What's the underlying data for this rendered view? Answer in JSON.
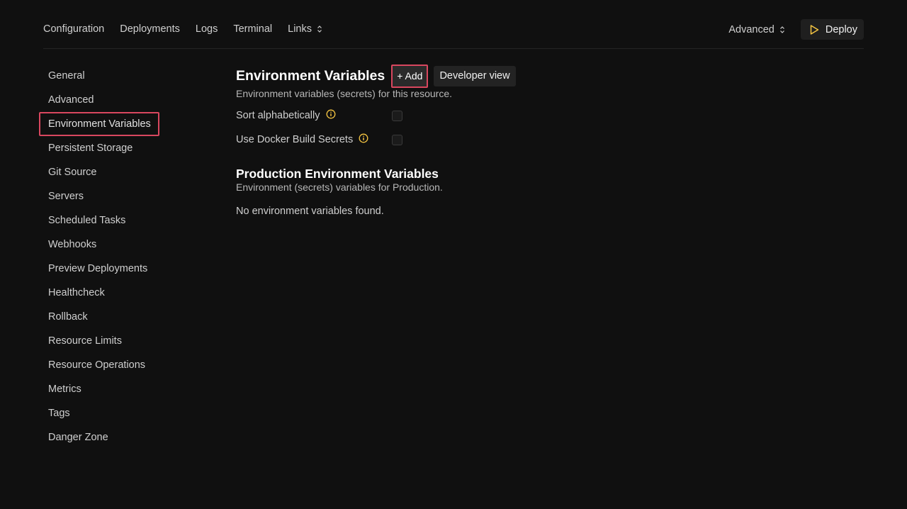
{
  "topnav": {
    "items": [
      "Configuration",
      "Deployments",
      "Logs",
      "Terminal",
      "Links"
    ],
    "advanced_label": "Advanced",
    "deploy_label": "Deploy"
  },
  "sidebar": {
    "items": [
      {
        "label": "General"
      },
      {
        "label": "Advanced"
      },
      {
        "label": "Environment Variables"
      },
      {
        "label": "Persistent Storage"
      },
      {
        "label": "Git Source"
      },
      {
        "label": "Servers"
      },
      {
        "label": "Scheduled Tasks"
      },
      {
        "label": "Webhooks"
      },
      {
        "label": "Preview Deployments"
      },
      {
        "label": "Healthcheck"
      },
      {
        "label": "Rollback"
      },
      {
        "label": "Resource Limits"
      },
      {
        "label": "Resource Operations"
      },
      {
        "label": "Metrics"
      },
      {
        "label": "Tags"
      },
      {
        "label": "Danger Zone"
      }
    ],
    "active": "Environment Variables"
  },
  "main": {
    "title": "Environment Variables",
    "add_label": "+ Add",
    "developer_view_label": "Developer view",
    "description": "Environment variables (secrets) for this resource.",
    "options": [
      {
        "label": "Sort alphabetically",
        "checked": false
      },
      {
        "label": "Use Docker Build Secrets",
        "checked": false
      }
    ],
    "production": {
      "title": "Production Environment Variables",
      "description": "Environment (secrets) variables for Production.",
      "empty_message": "No environment variables found."
    }
  },
  "colors": {
    "background": "#101010",
    "highlight": "#d9475f",
    "accent": "#f5c542"
  }
}
